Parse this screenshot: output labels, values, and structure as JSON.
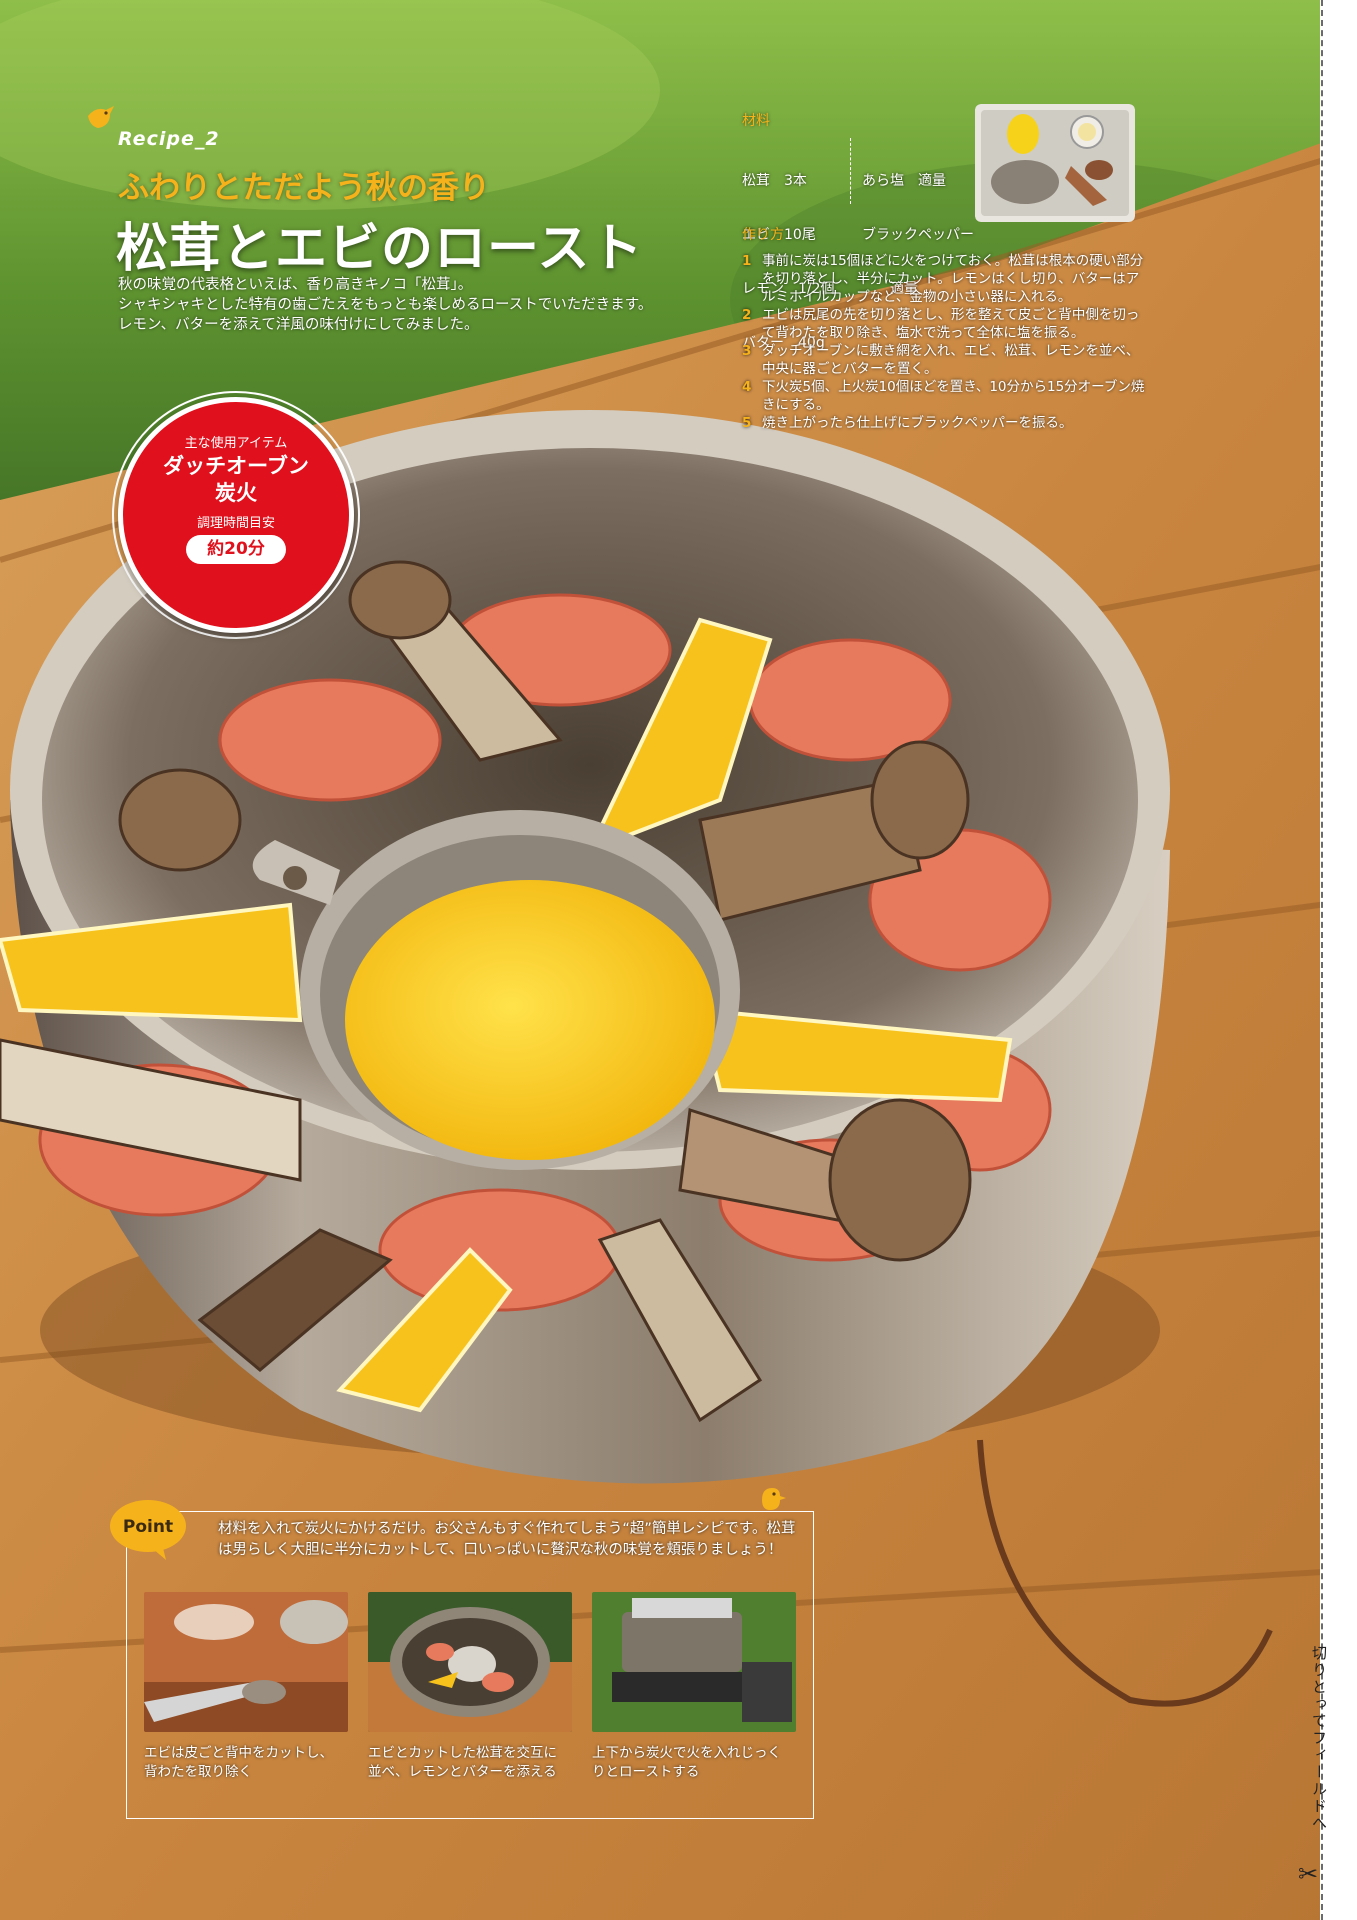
{
  "title": {
    "recipe_no": "Recipe_2",
    "subtitle": "ふわりとただよう秋の香り",
    "main": "松茸とエビのロースト",
    "intro": [
      "秋の味覚の代表格といえば、香り高きキノコ「松茸」。",
      "シャキシャキとした特有の歯ごたえをもっとも楽しめるローストでいただきます。",
      "レモン、バターを添えて洋風の味付けにしてみました。"
    ]
  },
  "badge": {
    "item_label": "主な使用アイテム",
    "items": [
      "ダッチオーブン",
      "炭火"
    ],
    "time_label": "調理時間目安",
    "time_value": "約20分"
  },
  "ingredients": {
    "heading": "材料",
    "left": [
      "松茸　3本",
      "エビ　10尾",
      "レモン　1/2個",
      "バター　40g"
    ],
    "right": [
      "あら塩　適量",
      "ブラックペッパー",
      "　　適量"
    ]
  },
  "steps": {
    "heading": "作り方",
    "items": [
      {
        "num": "1",
        "text": "事前に炭は15個ほどに火をつけておく。松茸は根本の硬い部分を切り落とし、半分にカット。レモンはくし切り、バターはアルミホイルカップなど、金物の小さい器に入れる。"
      },
      {
        "num": "2",
        "text": "エビは尻尾の先を切り落とし、形を整えて皮ごと背中側を切って背わたを取り除き、塩水で洗って全体に塩を振る。"
      },
      {
        "num": "3",
        "text": "ダッチオーブンに敷き網を入れ、エビ、松茸、レモンを並べ、中央に器ごとバターを置く。"
      },
      {
        "num": "4",
        "text": "下火炭5個、上火炭10個ほどを置き、10分から15分オーブン焼きにする。"
      },
      {
        "num": "5",
        "text": "焼き上がったら仕上げにブラックペッパーを振る。"
      }
    ]
  },
  "point": {
    "label": "Point",
    "text": [
      "材料を入れて炭火にかけるだけ。お父さんもすぐ作れてしまう“超”簡単レシピです。松茸",
      "は男らしく大胆に半分にカットして、口いっぱいに贅沢な秋の味覚を頬張りましょう！"
    ],
    "captions": [
      [
        "エビは皮ごと背中をカットし、",
        "背わたを取り除く"
      ],
      [
        "エビとカットした松茸を交互に",
        "並べ、レモンとバターを添える"
      ],
      [
        "上下から炭火で火を入れじっく",
        "りとローストする"
      ]
    ]
  },
  "side": {
    "label": "切りとってフィールドへ"
  },
  "colors": {
    "accent_yellow": "#f6b21b",
    "badge_red": "#e0101c",
    "wood": "#c98a44"
  }
}
